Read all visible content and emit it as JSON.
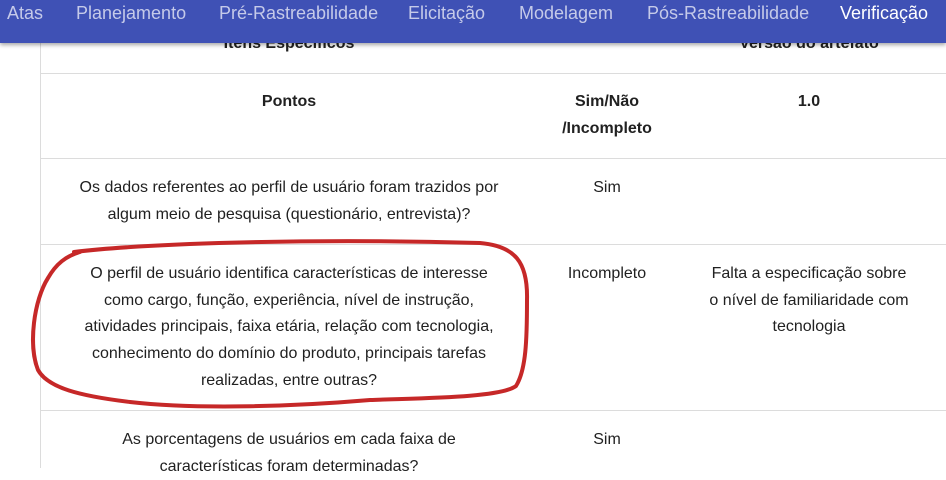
{
  "nav": {
    "items": [
      "Atas",
      "Planejamento",
      "Pré-Rastreabilidade",
      "Elicitação",
      "Modelagem",
      "Pós-Rastreabilidade",
      "Verificação"
    ],
    "active": "Verificação"
  },
  "table": {
    "top_headers": {
      "items": "Itens Específicos",
      "version": "Versão do artefato"
    },
    "headers": {
      "points": "Pontos",
      "status_line1": "Sim/Não",
      "status_line2": "/Incompleto",
      "version": "1.0"
    },
    "rows": [
      {
        "question_lines": [
          "Os dados referentes ao perfil de usuário foram trazidos por",
          "algum meio de pesquisa (questionário, entrevista)?"
        ],
        "status": "Sim",
        "note_lines": []
      },
      {
        "question_lines": [
          "O perfil de usuário identifica características de interesse",
          "como cargo, função, experiência, nível de instrução,",
          "atividades principais, faixa etária, relação com tecnologia,",
          "conhecimento do domínio do produto, principais tarefas",
          "realizadas, entre outras?"
        ],
        "status": "Incompleto",
        "note_lines": [
          "Falta a especificação sobre",
          "o nível de familiaridade com",
          "tecnologia"
        ]
      },
      {
        "question_lines": [
          "As porcentagens de usuários em cada faixa de",
          "características foram determinadas?"
        ],
        "status": "Sim",
        "note_lines": []
      }
    ]
  },
  "colors": {
    "navbar": "#3f51b5",
    "annotation": "#c62828"
  }
}
